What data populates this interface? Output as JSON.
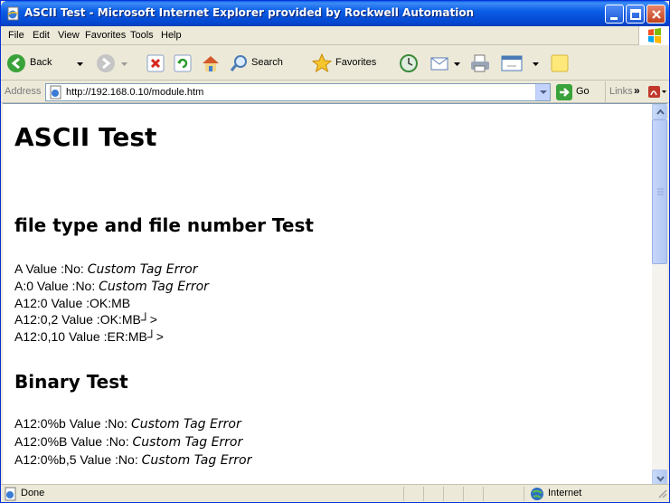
{
  "window": {
    "title": "ASCII Test - Microsoft Internet Explorer provided by Rockwell Automation"
  },
  "menu": [
    "File",
    "Edit",
    "View",
    "Favorites",
    "Tools",
    "Help"
  ],
  "toolbar": {
    "back_label": "Back",
    "search_label": "Search",
    "favorites_label": "Favorites"
  },
  "address": {
    "label": "Address",
    "url": "http://192.168.0.10/module.htm",
    "go_label": "Go",
    "links_label": "Links"
  },
  "page": {
    "h1": "ASCII Test",
    "section1": {
      "heading": "file type and file number Test",
      "lines": [
        {
          "prefix": "A Value :No: ",
          "em": "Custom Tag Error"
        },
        {
          "prefix": "A:0 Value :No: ",
          "em": "Custom Tag Error"
        },
        {
          "prefix": "A12:0 Value :OK:MB",
          "em": ""
        },
        {
          "prefix": "A12:0,2 Value :OK:MB┘>",
          "em": ""
        },
        {
          "prefix": "A12:0,10 Value :ER:MB┘>",
          "em": ""
        }
      ]
    },
    "section2": {
      "heading": "Binary Test",
      "lines": [
        {
          "prefix": "A12:0%b Value :No: ",
          "em": "Custom Tag Error"
        },
        {
          "prefix": "A12:0%B Value :No: ",
          "em": "Custom Tag Error"
        },
        {
          "prefix": "A12:0%b,5 Value :No: ",
          "em": "Custom Tag Error"
        }
      ]
    }
  },
  "status": {
    "text": "Done",
    "zone": "Internet"
  },
  "colors": {
    "titlebar": "#0a5fe8",
    "page_bg": "#ffffff",
    "chrome_bg": "#ece9d8"
  }
}
